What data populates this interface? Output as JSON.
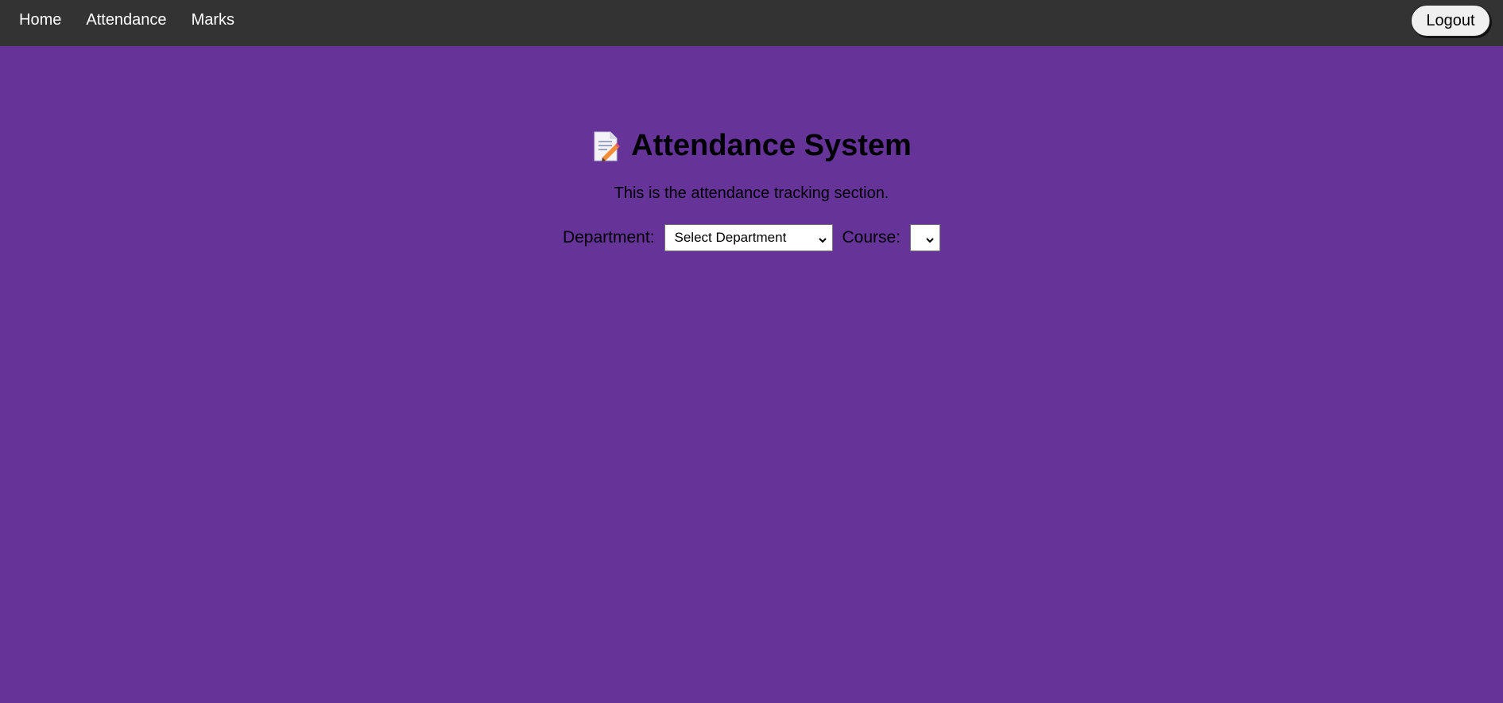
{
  "nav": {
    "links": [
      "Home",
      "Attendance",
      "Marks"
    ],
    "logout_label": "Logout"
  },
  "main": {
    "title_icon": "memo-icon",
    "title": "Attendance System",
    "intro": "This is the attendance tracking section.",
    "department_label": "Department:",
    "department_selected": "Select Department",
    "course_label": "Course:",
    "course_selected": ""
  },
  "colors": {
    "background": "#663399",
    "navbar": "#333333"
  }
}
